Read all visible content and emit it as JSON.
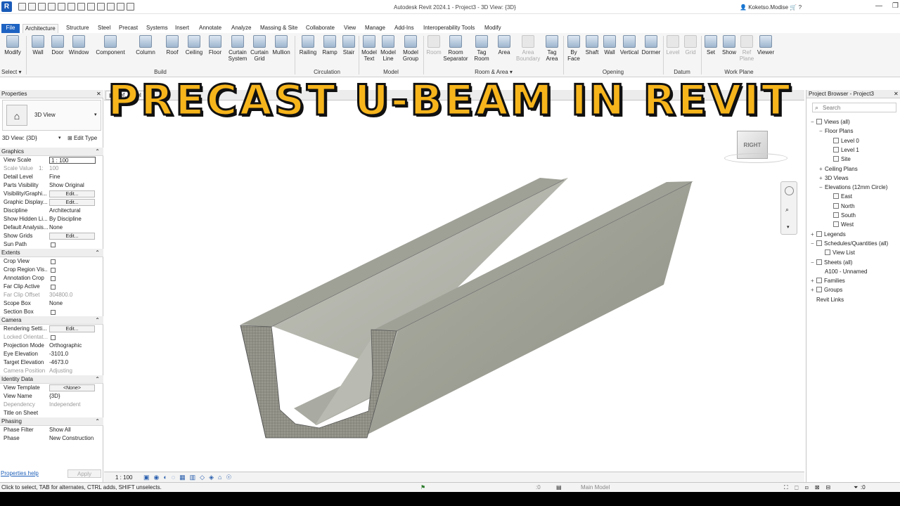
{
  "app": {
    "logo": "R",
    "title": "Autodesk Revit 2024.1 - Project3 - 3D View: {3D}",
    "user": "Koketso.Modise"
  },
  "tabs": [
    "File",
    "Architecture",
    "Structure",
    "Steel",
    "Precast",
    "Systems",
    "Insert",
    "Annotate",
    "Analyze",
    "Massing & Site",
    "Collaborate",
    "View",
    "Manage",
    "Add-Ins",
    "Interoperability Tools",
    "Modify"
  ],
  "ribbon": {
    "select": "Modify",
    "select_menu": "Select ▾",
    "build": {
      "label": "Build",
      "items": [
        "Wall",
        "Door",
        "Window",
        "Component",
        "Column",
        "Roof",
        "Ceiling",
        "Floor",
        "Curtain System",
        "Curtain Grid",
        "Mullion"
      ]
    },
    "circulation": {
      "label": "Circulation",
      "items": [
        "Railing",
        "Ramp",
        "Stair"
      ]
    },
    "model": {
      "label": "Model",
      "items": [
        "Model Text",
        "Model Line",
        "Model Group"
      ]
    },
    "room": {
      "label": "Room & Area ▾",
      "items": [
        "Room",
        "Room Separator",
        "Tag Room",
        "Area",
        "Area Boundary",
        "Tag Area"
      ]
    },
    "opening": {
      "label": "Opening",
      "items": [
        "By Face",
        "Shaft",
        "Wall",
        "Vertical",
        "Dormer"
      ]
    },
    "datum": {
      "label": "Datum",
      "items": [
        "Level",
        "Grid"
      ]
    },
    "workplane": {
      "label": "Work Plane",
      "items": [
        "Set",
        "Show",
        "Ref Plane",
        "Viewer"
      ]
    }
  },
  "properties": {
    "title": "Properties",
    "type_name": "3D View",
    "instance": "3D View: {3D}",
    "edit_type": "Edit Type",
    "sections": [
      {
        "name": "Graphics",
        "rows": [
          {
            "k": "View Scale",
            "v": "1 : 100",
            "kind": "input"
          },
          {
            "k": "Scale Value",
            "v": "100",
            "extra": "1:",
            "dim": true
          },
          {
            "k": "Detail Level",
            "v": "Fine"
          },
          {
            "k": "Parts Visibility",
            "v": "Show Original"
          },
          {
            "k": "Visibility/Graphi...",
            "v": "Edit...",
            "kind": "btn"
          },
          {
            "k": "Graphic Display...",
            "v": "Edit...",
            "kind": "btn"
          },
          {
            "k": "Discipline",
            "v": "Architectural"
          },
          {
            "k": "Show Hidden Li...",
            "v": "By Discipline"
          },
          {
            "k": "Default Analysis...",
            "v": "None"
          },
          {
            "k": "Show Grids",
            "v": "Edit...",
            "kind": "btn"
          },
          {
            "k": "Sun Path",
            "kind": "chk"
          }
        ]
      },
      {
        "name": "Extents",
        "rows": [
          {
            "k": "Crop View",
            "kind": "chk"
          },
          {
            "k": "Crop Region Vis...",
            "kind": "chk"
          },
          {
            "k": "Annotation Crop",
            "kind": "chk"
          },
          {
            "k": "Far Clip Active",
            "kind": "chk"
          },
          {
            "k": "Far Clip Offset",
            "v": "304800.0",
            "dim": true
          },
          {
            "k": "Scope Box",
            "v": "None"
          },
          {
            "k": "Section Box",
            "kind": "chk"
          }
        ]
      },
      {
        "name": "Camera",
        "rows": [
          {
            "k": "Rendering Setti...",
            "v": "Edit...",
            "kind": "btn"
          },
          {
            "k": "Locked Orientat...",
            "kind": "chk",
            "dim": true
          },
          {
            "k": "Projection Mode",
            "v": "Orthographic"
          },
          {
            "k": "Eye Elevation",
            "v": "-3101.0"
          },
          {
            "k": "Target Elevation",
            "v": "-4673.0"
          },
          {
            "k": "Camera Position",
            "v": "Adjusting",
            "dim": true
          }
        ]
      },
      {
        "name": "Identity Data",
        "rows": [
          {
            "k": "View Template",
            "v": "<None>",
            "kind": "btn"
          },
          {
            "k": "View Name",
            "v": "{3D}"
          },
          {
            "k": "Dependency",
            "v": "Independent",
            "dim": true
          },
          {
            "k": "Title on Sheet",
            "v": ""
          }
        ]
      },
      {
        "name": "Phasing",
        "rows": [
          {
            "k": "Phase Filter",
            "v": "Show All"
          },
          {
            "k": "Phase",
            "v": "New Construction"
          }
        ]
      }
    ],
    "help": "Properties help",
    "apply": "Apply"
  },
  "view": {
    "tab_label": "Ref. Level",
    "scale": "1 : 100",
    "overlay_title": "PRECAST U-BEAM IN REVIT",
    "viewcube": "RIGHT"
  },
  "browser": {
    "title": "Project Browser - Project3",
    "search_placeholder": "Search",
    "items": [
      {
        "t": "Views (all)",
        "l": 0,
        "pm": "−",
        "box": true
      },
      {
        "t": "Floor Plans",
        "l": 1,
        "pm": "−"
      },
      {
        "t": "Level 0",
        "l": 2,
        "box": true
      },
      {
        "t": "Level 1",
        "l": 2,
        "box": true
      },
      {
        "t": "Site",
        "l": 2,
        "box": true
      },
      {
        "t": "Ceiling Plans",
        "l": 1,
        "pm": "+"
      },
      {
        "t": "3D Views",
        "l": 1,
        "pm": "+"
      },
      {
        "t": "Elevations (12mm Circle)",
        "l": 1,
        "pm": "−"
      },
      {
        "t": "East",
        "l": 2,
        "box": true
      },
      {
        "t": "North",
        "l": 2,
        "box": true
      },
      {
        "t": "South",
        "l": 2,
        "box": true
      },
      {
        "t": "West",
        "l": 2,
        "box": true
      },
      {
        "t": "Legends",
        "l": 0,
        "pm": "+",
        "box": true
      },
      {
        "t": "Schedules/Quantities (all)",
        "l": 0,
        "pm": "−",
        "box": true
      },
      {
        "t": "View List",
        "l": 1,
        "box": true
      },
      {
        "t": "Sheets (all)",
        "l": 0,
        "pm": "−",
        "box": true
      },
      {
        "t": "A100 - Unnamed",
        "l": 1
      },
      {
        "t": "Families",
        "l": 0,
        "pm": "+",
        "box": true
      },
      {
        "t": "Groups",
        "l": 0,
        "pm": "+",
        "box": true
      },
      {
        "t": "Revit Links",
        "l": 0
      }
    ]
  },
  "status": {
    "text": "Click to select, TAB for alternates, CTRL adds, SHIFT unselects.",
    "workset": ":0",
    "model": "Main Model",
    "filter": ":0"
  }
}
